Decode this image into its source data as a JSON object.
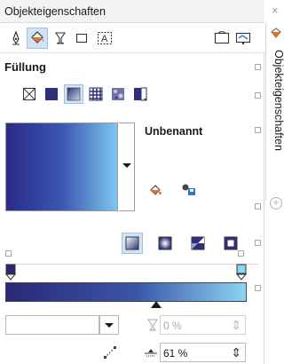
{
  "panel": {
    "title": "Objekteigenschaften",
    "close_glyph": "×",
    "side_tab_label": "Objekteigenschaften",
    "add_tab_glyph": "+"
  },
  "toolbar": {
    "icons": [
      "outline-pen-icon",
      "fill-bucket-icon",
      "transparency-glass-icon",
      "frame-icon",
      "text-frame-icon",
      "window-icon",
      "display-icon"
    ],
    "active": "fill-bucket-icon"
  },
  "fill": {
    "section_label": "Füllung",
    "fill_types": [
      "no-fill-icon",
      "uniform-fill-icon",
      "fountain-fill-icon",
      "pattern-fill-icon",
      "texture-fill-icon",
      "postscript-fill-icon"
    ],
    "active_fill_type": "fountain-fill-icon",
    "preset_name": "Unbenannt",
    "gradient_colors": [
      "#2a2777",
      "#3b57a9",
      "#8cd4f2"
    ],
    "gradient_types": [
      "linear-gradient-icon",
      "radial-gradient-icon",
      "conical-gradient-icon",
      "rectangular-gradient-icon"
    ],
    "active_gradient_type": "linear-gradient-icon",
    "node_left_color": "#2a2777",
    "node_right_color": "#8cd4f2",
    "transparency_value": "0 %",
    "position_value": "61 %"
  }
}
